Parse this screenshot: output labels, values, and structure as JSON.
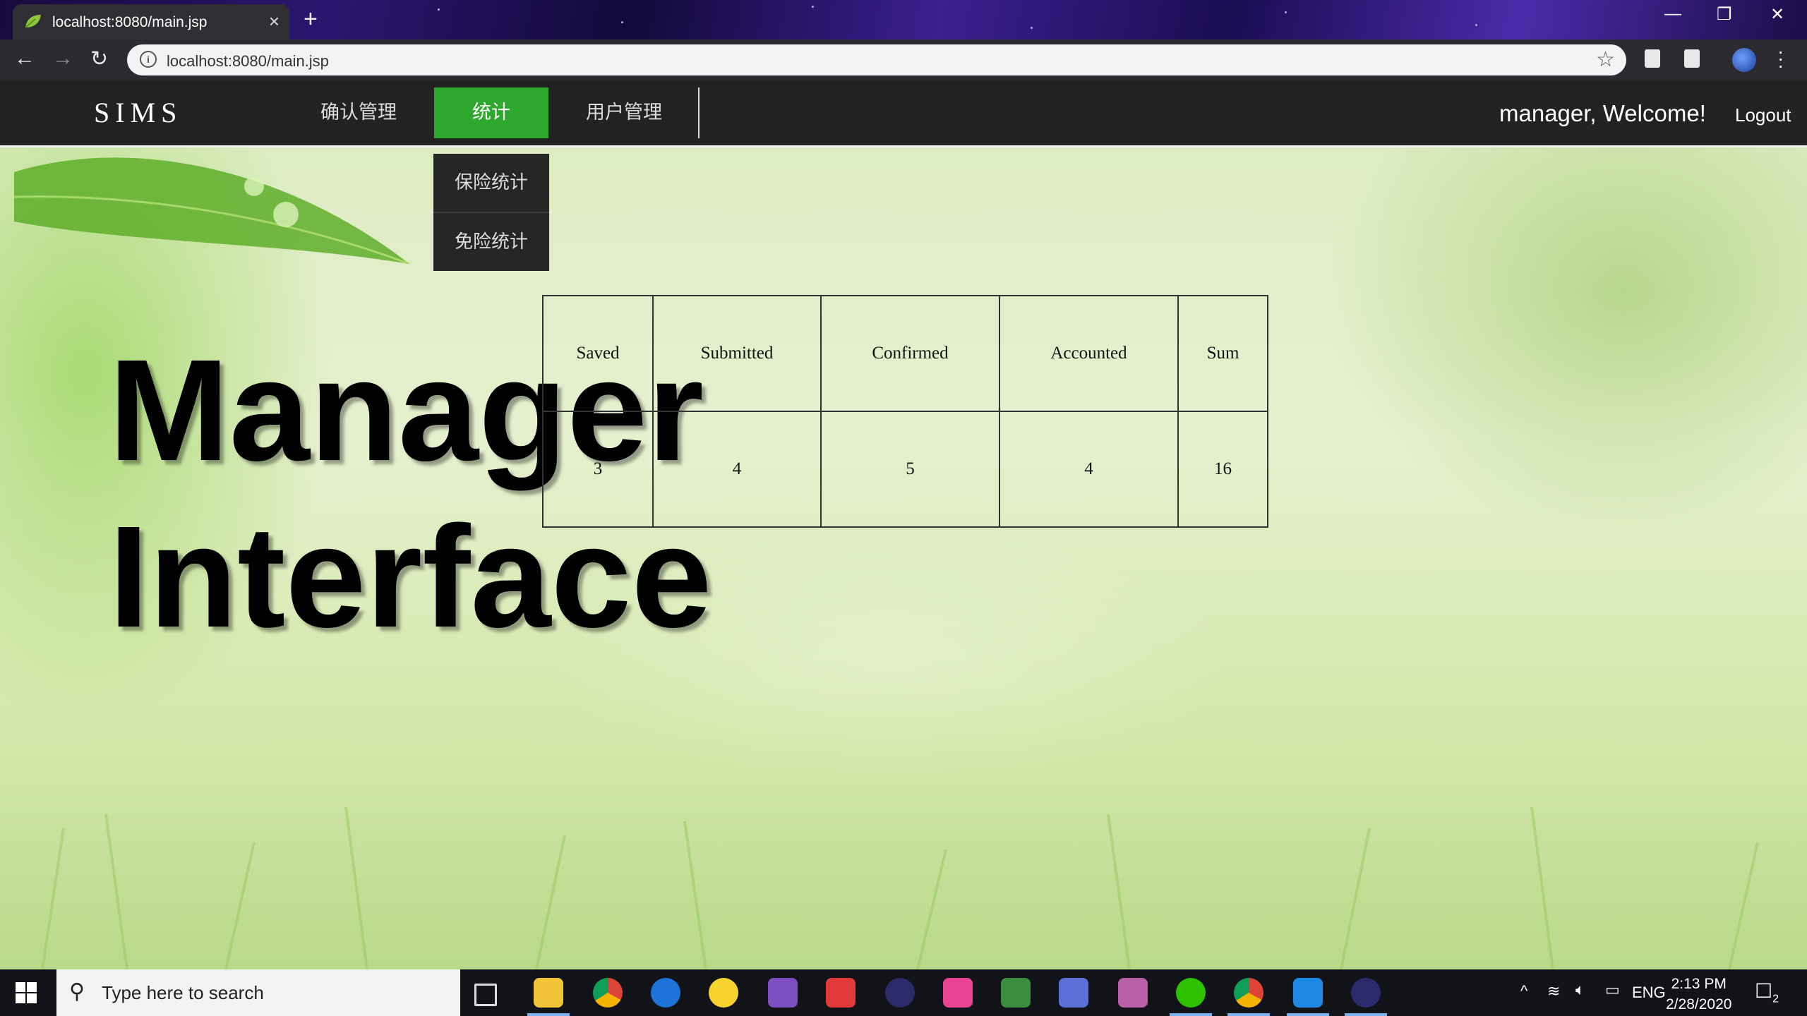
{
  "browser": {
    "tab_title": "localhost:8080/main.jsp",
    "url": "localhost:8080/main.jsp",
    "new_tab_label": "+",
    "close_tab_label": "×"
  },
  "navbar": {
    "brand": "SIMS",
    "items": [
      {
        "label": "确认管理",
        "active": false
      },
      {
        "label": "统计",
        "active": true
      },
      {
        "label": "用户管理",
        "active": false
      }
    ],
    "active_color": "#2fa82f",
    "welcome_text": "manager, Welcome!",
    "logout_label": "Logout"
  },
  "dropdown": {
    "items": [
      "保险统计",
      "免险统计"
    ]
  },
  "headline": {
    "line1": "Manager",
    "line2": "Interface"
  },
  "stats_table": {
    "headers": [
      "Saved",
      "Submitted",
      "Confirmed",
      "Accounted",
      "Sum"
    ],
    "values": [
      "3",
      "4",
      "5",
      "4",
      "16"
    ]
  },
  "taskbar": {
    "search_placeholder": "Type here to search",
    "tray_language": "ENG",
    "time": "2:13 PM",
    "date": "2/28/2020",
    "notification_count": "2"
  }
}
